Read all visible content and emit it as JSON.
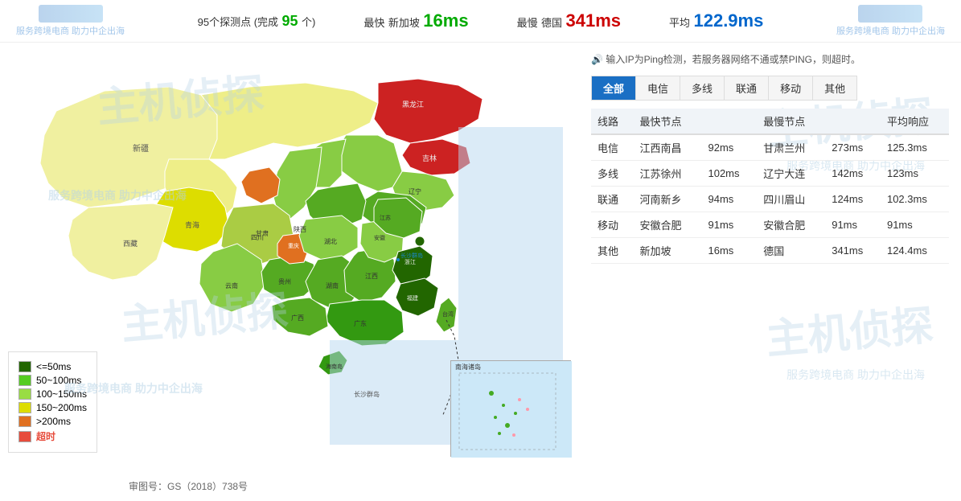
{
  "header": {
    "probe_count_label": "95个探测点 (完成",
    "probe_count_value": "95",
    "probe_count_unit": "个)",
    "fastest_label": "最快",
    "fastest_location": "新加坡",
    "fastest_value": "16ms",
    "slowest_label": "最慢",
    "slowest_location": "德国",
    "slowest_value": "341ms",
    "avg_label": "平均",
    "avg_value": "122.9ms",
    "watermark1": "主机侦探",
    "watermark_service1": "服务跨境电商 助力中企出海",
    "watermark2": "主机侦探",
    "watermark_service2": "服务跨境电商 助力中企出海"
  },
  "ip_notice": "输入IP为Ping检测，若服务器网络不通或禁PING，则超时。",
  "tabs": [
    {
      "label": "全部",
      "active": true
    },
    {
      "label": "电信",
      "active": false
    },
    {
      "label": "多线",
      "active": false
    },
    {
      "label": "联通",
      "active": false
    },
    {
      "label": "移动",
      "active": false
    },
    {
      "label": "其他",
      "active": false
    }
  ],
  "table": {
    "headers": [
      "线路",
      "最快节点",
      "",
      "最慢节点",
      "",
      "平均响应"
    ],
    "rows": [
      {
        "line": "电信",
        "fast_node": "江西南昌",
        "fast_ms": "92ms",
        "slow_node": "甘肃兰州",
        "slow_ms": "273ms",
        "avg": "125.3ms"
      },
      {
        "line": "多线",
        "fast_node": "江苏徐州",
        "fast_ms": "102ms",
        "slow_node": "辽宁大连",
        "slow_ms": "142ms",
        "avg": "123ms"
      },
      {
        "line": "联通",
        "fast_node": "河南新乡",
        "fast_ms": "94ms",
        "slow_node": "四川眉山",
        "slow_ms": "124ms",
        "avg": "102.3ms"
      },
      {
        "line": "移动",
        "fast_node": "安徽合肥",
        "fast_ms": "91ms",
        "slow_node": "安徽合肥",
        "slow_ms": "91ms",
        "avg": "91ms"
      },
      {
        "line": "其他",
        "fast_node": "新加坡",
        "fast_ms": "16ms",
        "slow_node": "德国",
        "slow_ms": "341ms",
        "avg": "124.4ms"
      }
    ]
  },
  "legend": [
    {
      "color": "#226600",
      "label": "<=50ms"
    },
    {
      "color": "#44aa22",
      "label": "50~100ms"
    },
    {
      "color": "#88cc44",
      "label": "100~150ms"
    },
    {
      "color": "#dddd00",
      "label": "150~200ms"
    },
    {
      "color": "#e07020",
      "label": ">200ms"
    },
    {
      "color": "#e74c3c",
      "label": "超时",
      "is_timeout": true
    }
  ],
  "audit": "审图号：GS（2018）738号",
  "small_map_label": "南海诸岛",
  "watermarks": {
    "map_wm1": "主机侦探",
    "map_service1": "服务跨境电商 助力中企出海",
    "map_wm2": "主机侦探",
    "map_service2": "服务跨境电商 助力中企出海",
    "right_wm1": "主机侦探",
    "right_service1": "服务跨境电商 助力中企出海",
    "right_wm2": "主机侦探",
    "right_service2": "服务跨境电商 助力中企出海"
  }
}
